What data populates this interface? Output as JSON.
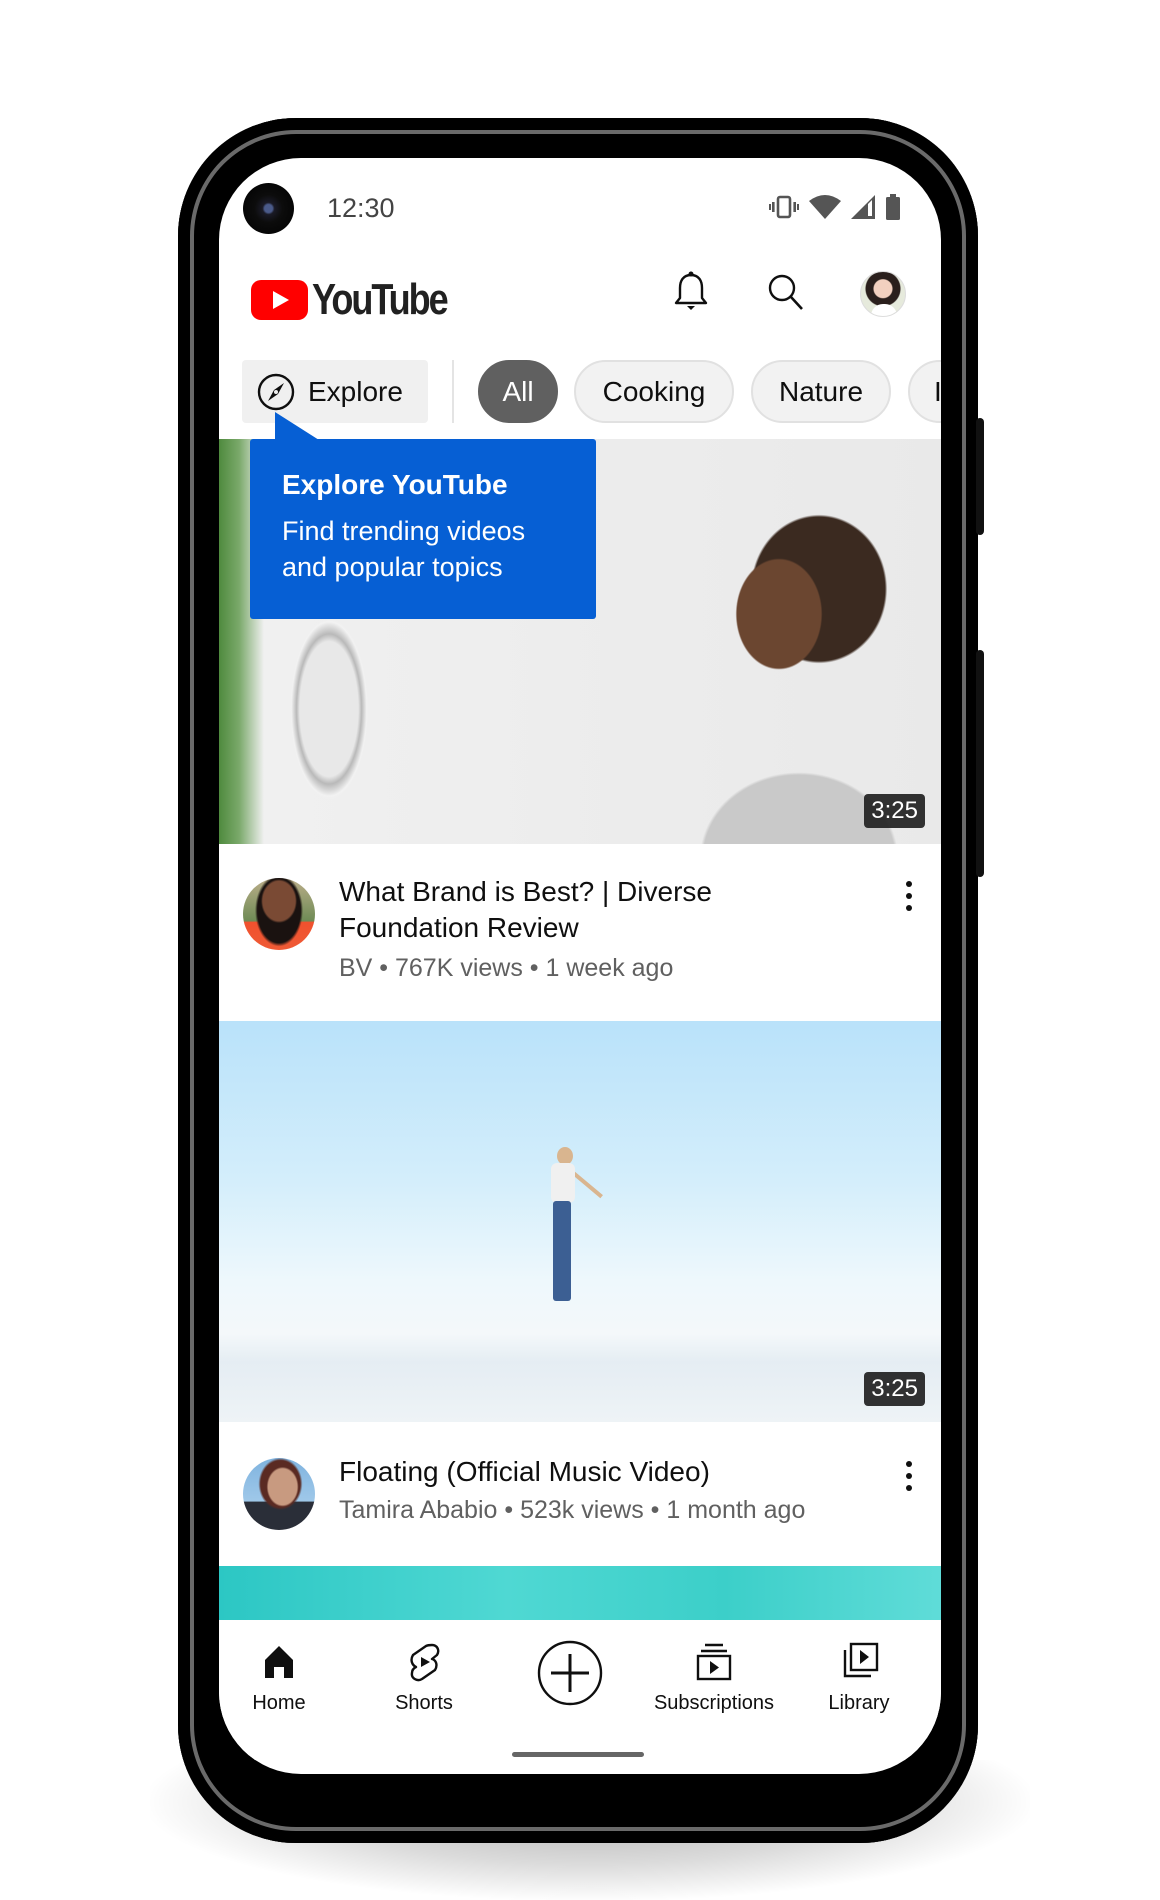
{
  "status_bar": {
    "time": "12:30",
    "icons": [
      "vibrate-icon",
      "wifi-icon",
      "cell-signal-icon",
      "battery-icon"
    ]
  },
  "header": {
    "logo_text": "YouTube",
    "brand_color": "#FF0000",
    "icons": [
      "bell-icon",
      "search-icon",
      "account-avatar"
    ]
  },
  "chips": {
    "explore_label": "Explore",
    "items": [
      {
        "label": "All",
        "selected": true
      },
      {
        "label": "Cooking",
        "selected": false
      },
      {
        "label": "Nature",
        "selected": false
      },
      {
        "label": "I",
        "selected": false
      }
    ]
  },
  "tooltip": {
    "title": "Explore YouTube",
    "body_line1": "Find trending videos",
    "body_line2": "and popular topics",
    "color": "#065FD4"
  },
  "videos": [
    {
      "title": "What Brand is Best? | Diverse Foundation Review",
      "channel": "BV",
      "views": "767K views",
      "age": "1 week ago",
      "duration": "3:25",
      "subtitle": "BV •  767K views • 1 week ago"
    },
    {
      "title": "Floating (Official Music Video)",
      "channel": "Tamira Ababio",
      "views": "523k views",
      "age": "1 month ago",
      "duration": "3:25",
      "subtitle": "Tamira Ababio •  523k views • 1 month ago"
    }
  ],
  "bottom_nav": {
    "items": [
      {
        "label": "Home",
        "icon": "home-icon",
        "active": true
      },
      {
        "label": "Shorts",
        "icon": "shorts-icon",
        "active": false
      },
      {
        "label": "",
        "icon": "create-icon",
        "active": false
      },
      {
        "label": "Subscriptions",
        "icon": "subscriptions-icon",
        "active": false
      },
      {
        "label": "Library",
        "icon": "library-icon",
        "active": false
      }
    ]
  }
}
